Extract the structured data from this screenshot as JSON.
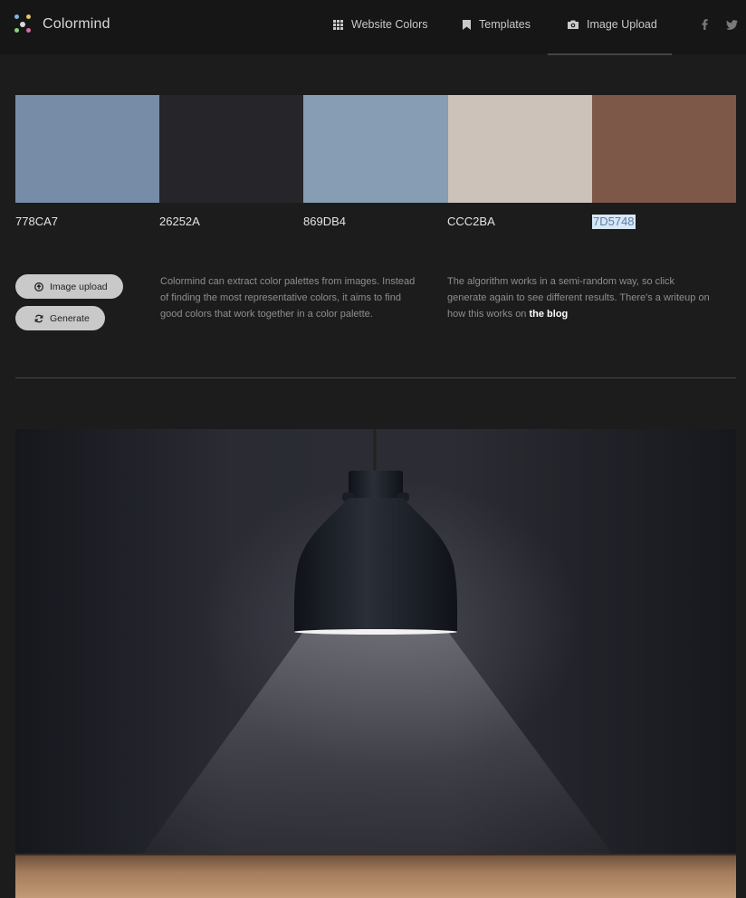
{
  "nav": {
    "brand": "Colormind",
    "links": [
      "Website Colors",
      "Templates",
      "Image Upload"
    ],
    "social": [
      "facebook-icon",
      "twitter-icon"
    ]
  },
  "palette": [
    {
      "hex": "778CA7",
      "color": "#778CA7"
    },
    {
      "hex": "26252A",
      "color": "#26252A"
    },
    {
      "hex": "869DB4",
      "color": "#869DB4"
    },
    {
      "hex": "CCC2BA",
      "color": "#CCC2BA"
    },
    {
      "hex": "7D5748",
      "color": "#7D5748"
    }
  ],
  "buttons": {
    "upload": "Image upload",
    "generate": "Generate"
  },
  "text": {
    "intro": "Colormind can extract color palettes from images. Instead of finding the most representative colors, it aims to find good colors that work together in a color palette.",
    "algo": "The algorithm works in a semi-random way, so click generate again to see different results. There's a writeup on how this works on",
    "blog_link": "the blog"
  },
  "colors": {
    "background": "#1c1c1c",
    "navbar": "#161616",
    "button": "#c9c9c9"
  }
}
